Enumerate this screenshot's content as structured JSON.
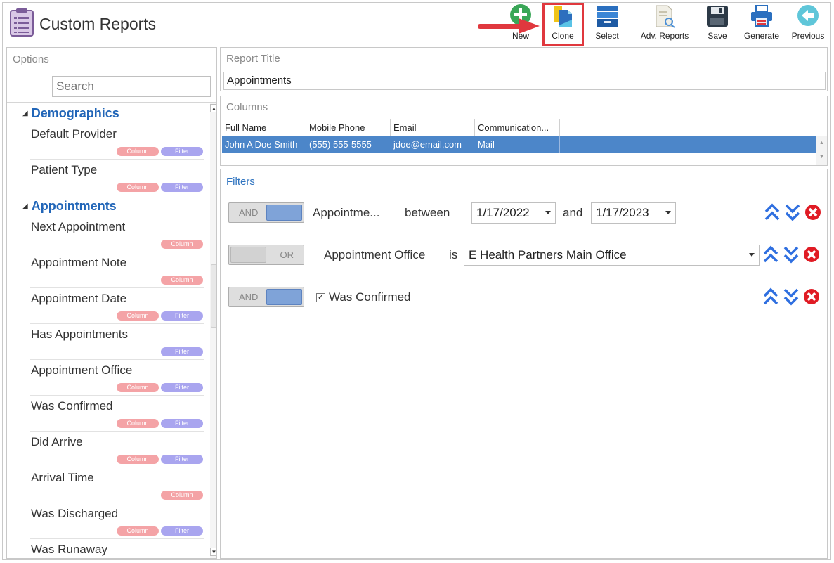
{
  "app": {
    "title": "Custom Reports"
  },
  "toolbar": {
    "new": "New",
    "clone": "Clone",
    "select": "Select",
    "adv_reports": "Adv. Reports",
    "save": "Save",
    "generate": "Generate",
    "previous": "Previous"
  },
  "options": {
    "header": "Options",
    "search_placeholder": "Search",
    "tag_column": "Column",
    "tag_filter": "Filter",
    "groups": [
      {
        "name": "Demographics",
        "items": [
          "Default Provider",
          "Patient Type"
        ]
      },
      {
        "name": "Appointments",
        "items": [
          "Next Appointment",
          "Appointment Note",
          "Appointment Date",
          "Has Appointments",
          "Appointment Office",
          "Was Confirmed",
          "Did Arrive",
          "Arrival Time",
          "Was Discharged",
          "Was Runaway"
        ]
      }
    ]
  },
  "report": {
    "title_header": "Report Title",
    "title_value": "Appointments"
  },
  "columns": {
    "header": "Columns",
    "headers": [
      "Full Name",
      "Mobile Phone",
      "Email",
      "Communication..."
    ],
    "row": [
      "John A Doe Smith",
      "(555) 555-5555",
      "jdoe@email.com",
      "Mail"
    ]
  },
  "filters": {
    "header": "Filters",
    "rows": [
      {
        "logic": "AND",
        "field": "Appointme...",
        "operator": "between",
        "from": "1/17/2022",
        "conj": "and",
        "to": "1/17/2023"
      },
      {
        "logic": "OR",
        "field": "Appointment Office",
        "operator": "is",
        "value": "E Health Partners Main Office"
      },
      {
        "logic": "AND",
        "checked": "✓",
        "field": "Was Confirmed"
      }
    ]
  },
  "colors": {
    "accent_blue": "#2266b8",
    "highlight_red": "#e0383e",
    "row_selected": "#4c86c9",
    "tag_column": "#f4a3a6",
    "tag_filter": "#a9a5ef"
  }
}
